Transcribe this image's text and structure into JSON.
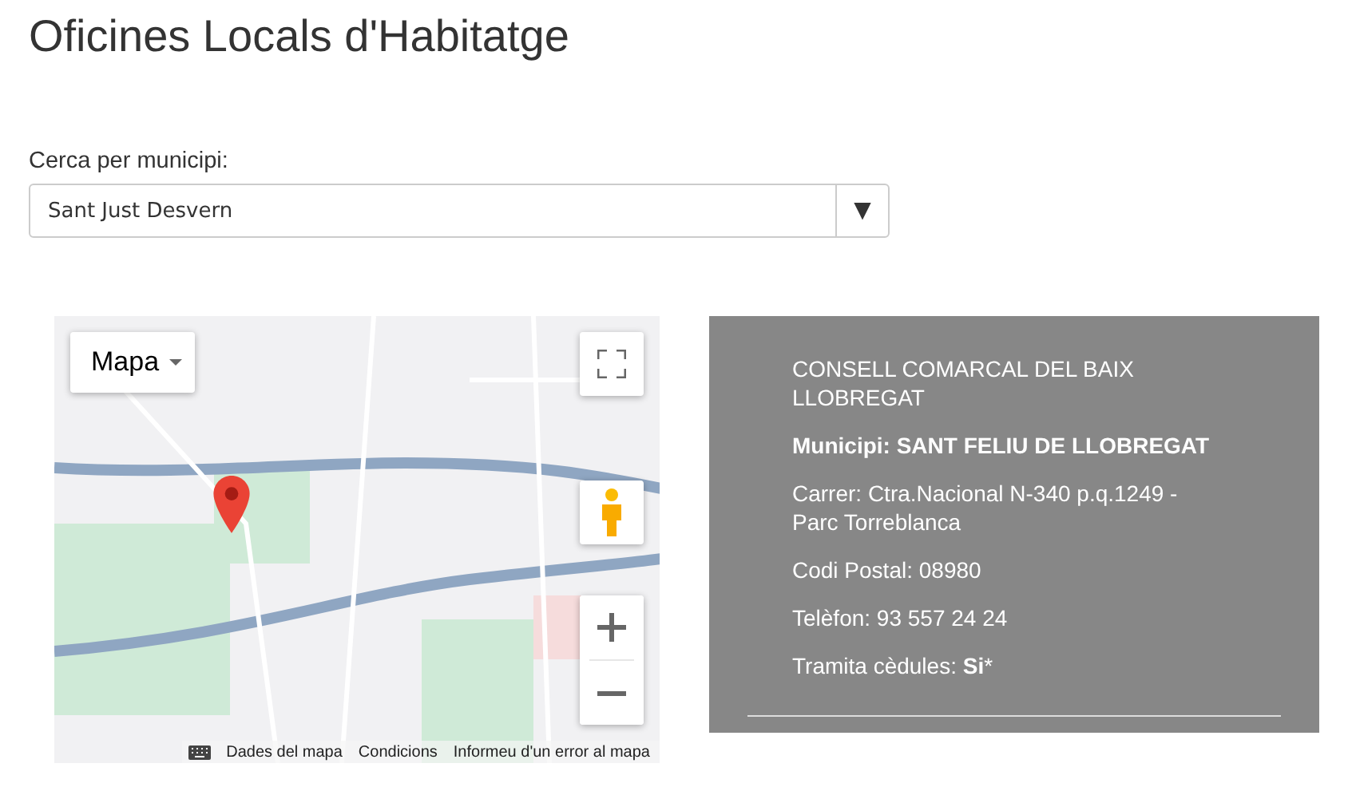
{
  "page": {
    "title": "Oficines Locals d'Habitatge"
  },
  "search": {
    "label": "Cerca per municipi:",
    "value": "Sant Just Desvern",
    "toggle": "▼"
  },
  "map": {
    "type_control": "Mapa",
    "footer_links": [
      "Dades del mapa",
      "Condicions",
      "Informeu d'un error al mapa"
    ]
  },
  "office": {
    "lines": [
      {
        "text": "CONSELL COMARCAL DEL BAIX LLOBREGAT",
        "bold": false
      },
      {
        "text": "Municipi: SANT FELIU DE LLOBREGAT",
        "bold": true
      },
      {
        "text": "Carrer: Ctra.Nacional N-340 p.q.1249 - Parc Torreblanca",
        "bold": false
      },
      {
        "text": "Codi Postal: 08980",
        "bold": false
      },
      {
        "text": "Telèfon: 93 557 24 24",
        "bold": false
      },
      {
        "text": "Tramita cèdules: **Si***",
        "bold": false
      }
    ]
  }
}
